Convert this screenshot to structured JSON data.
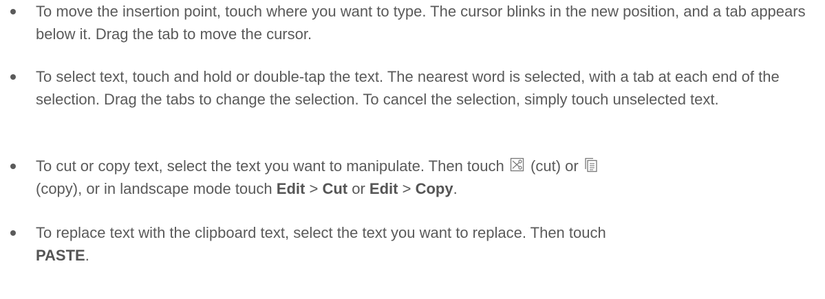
{
  "bullets": [
    {
      "text": "To move the insertion point, touch where you want to type. The cursor blinks in the new position, and a tab appears below it. Drag the tab to move the cursor."
    },
    {
      "text": "To select text, touch and hold or double-tap the text. The nearest word is selected, with a tab at each end of the selection. Drag the tabs to change the selection. To cancel the selection, simply touch unselected text."
    },
    {
      "part1": "To cut or copy text, select the text you want to manipulate. Then touch",
      "part2": "(cut) or",
      "part3": "(copy), or in landscape mode touch",
      "edit1": "Edit",
      "sep1": ">",
      "cut": "Cut",
      "or": "or",
      "edit2": "Edit",
      "sep2": ">",
      "copy": "Copy",
      "end": ".",
      "cut_icon": "cut-icon",
      "copy_icon": "copy-icon"
    },
    {
      "text": "To replace text with the clipboard text, select the text you want to replace. Then touch",
      "paste": "PASTE",
      "end": "."
    }
  ]
}
